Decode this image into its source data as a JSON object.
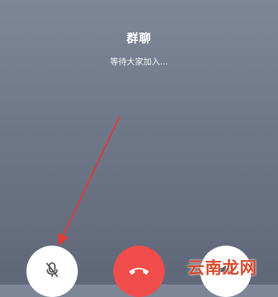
{
  "call": {
    "title": "群聊",
    "status": "等待大家加入..."
  },
  "controls": {
    "mute_icon": "mic-muted-icon",
    "hangup_icon": "phone-hangup-icon",
    "speaker_icon": "speaker-icon"
  },
  "annotation": {
    "arrow_color": "#e53935"
  },
  "watermark": {
    "text": "云南龙网"
  },
  "colors": {
    "background": "#6f7889",
    "hangup": "#f24d4d",
    "button_light": "#ffffff"
  }
}
